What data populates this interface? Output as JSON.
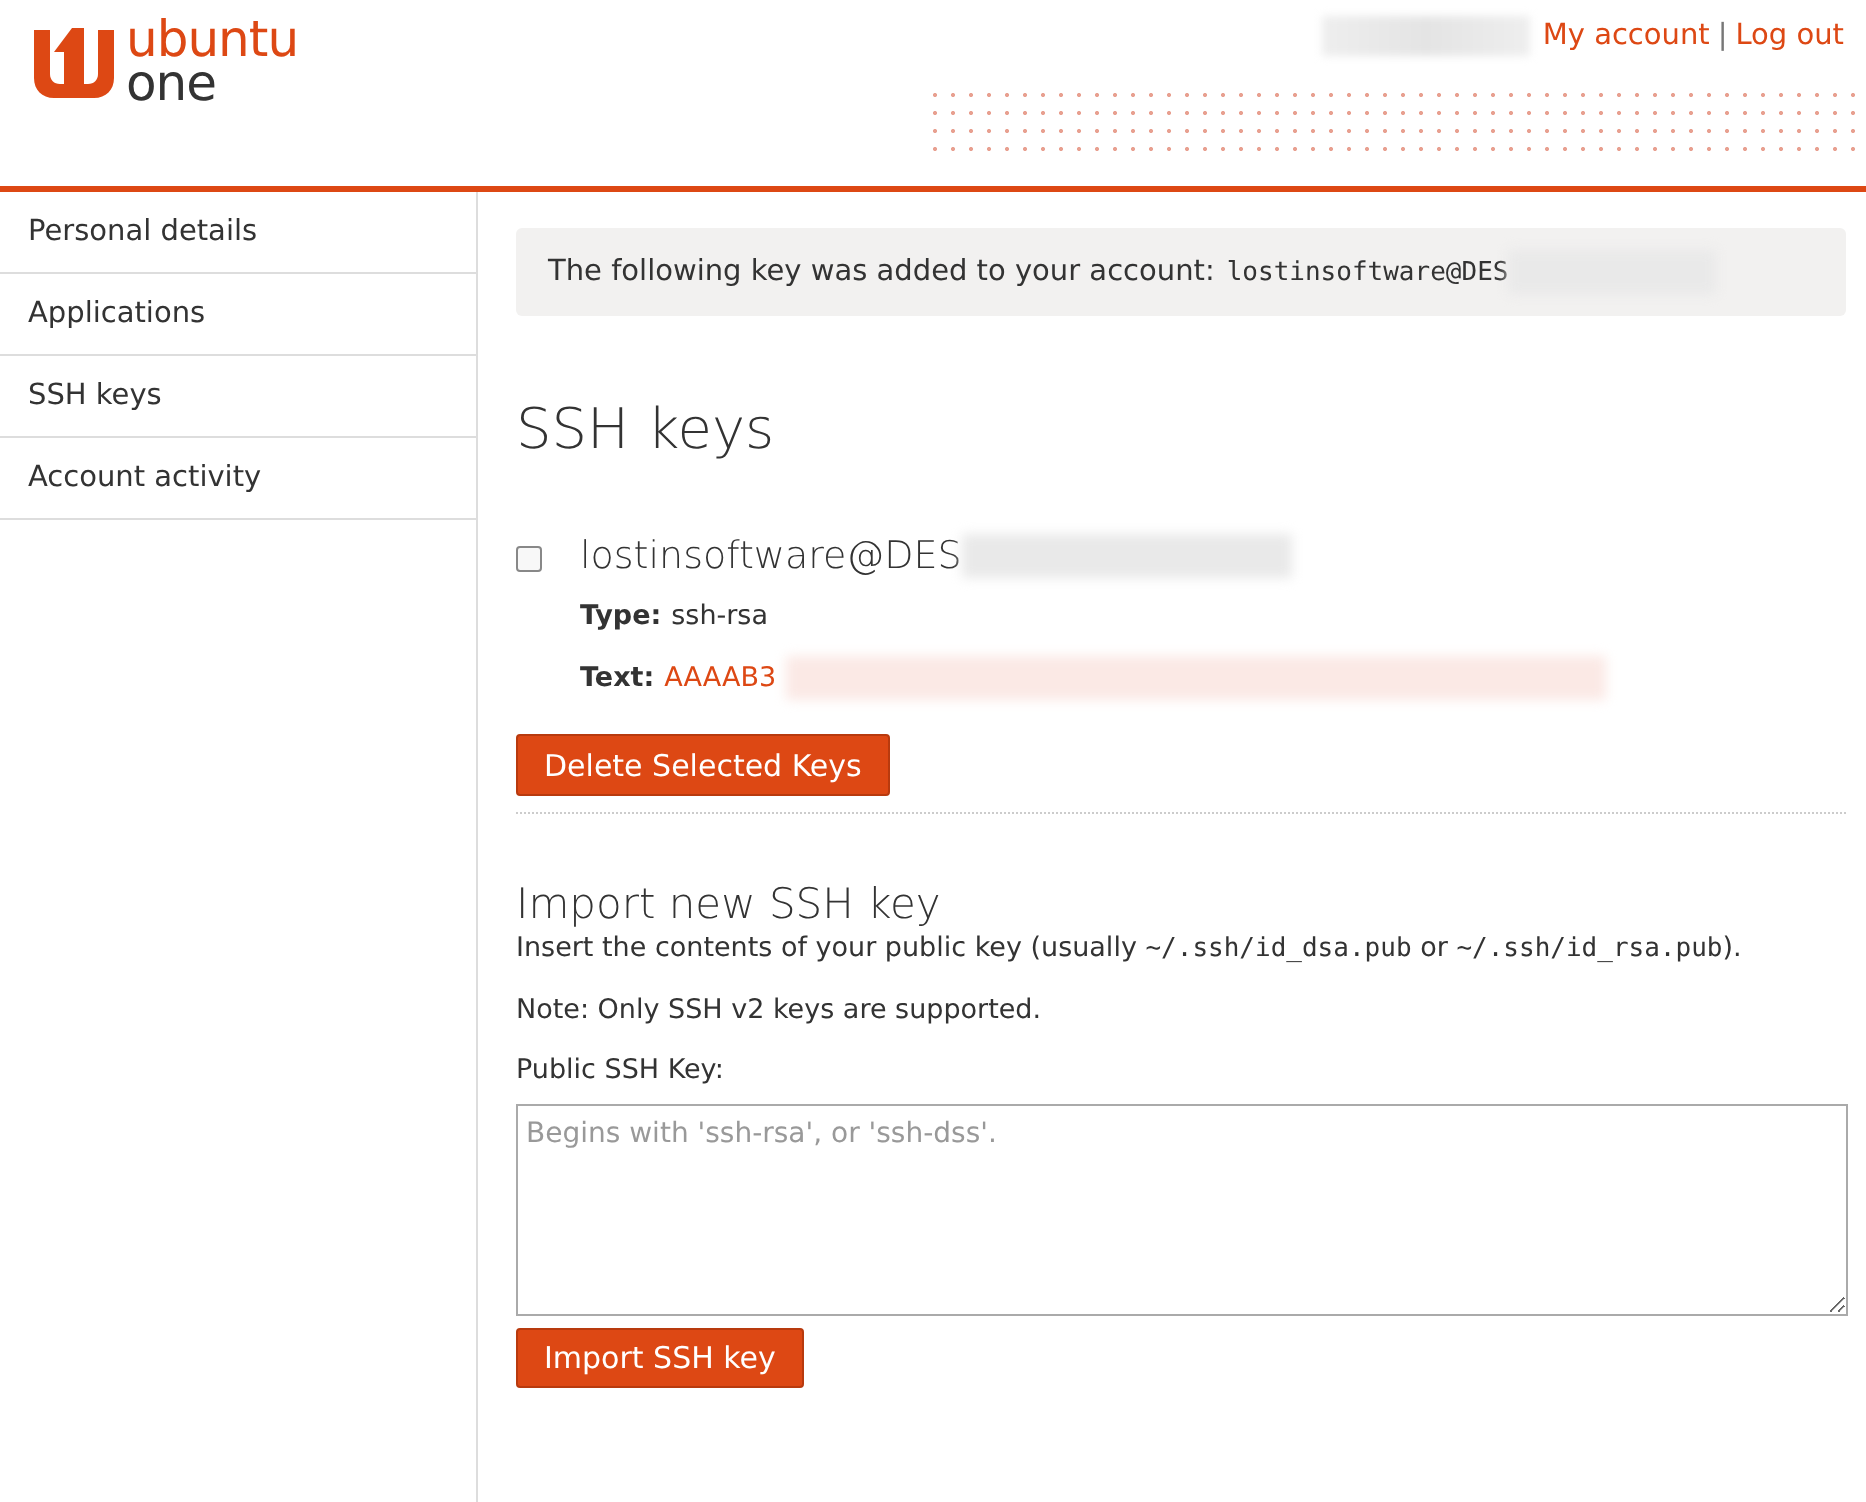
{
  "header": {
    "logo_top": "ubuntu",
    "logo_bottom": "one",
    "links": [
      {
        "label": "My account"
      },
      {
        "label": "Log out"
      }
    ],
    "separator": "|"
  },
  "sidebar": {
    "items": [
      {
        "label": "Personal details",
        "selected": false
      },
      {
        "label": "Applications",
        "selected": false
      },
      {
        "label": "SSH keys",
        "selected": false
      },
      {
        "label": "Account activity",
        "selected": false
      }
    ]
  },
  "notice": {
    "text": "The following key was added to your account:",
    "key": "lostinsoftware@DES"
  },
  "heading": "SSH keys",
  "keys": [
    {
      "name": "lostinsoftware@DES",
      "checked": false,
      "type_label": "Type:",
      "type": "ssh-rsa",
      "text_label": "Text:",
      "text": "AAAAB3"
    }
  ],
  "delete_button": "Delete Selected Keys",
  "import": {
    "heading": "Import new SSH key",
    "description": [
      {
        "kind": "plain",
        "text": "Insert the contents of your public key (usually "
      },
      {
        "kind": "code",
        "text": "~/.ssh/id_dsa.pub"
      },
      {
        "kind": "plain",
        "text": " or "
      },
      {
        "kind": "code",
        "text": "~/.ssh/id_rsa.pub"
      },
      {
        "kind": "plain",
        "text": ")."
      }
    ],
    "note": "Note: Only SSH v2 keys are supported.",
    "field_label": "Public SSH Key:",
    "placeholder": "Begins with 'ssh-rsa', or 'ssh-dss'.",
    "button": "Import SSH key"
  }
}
